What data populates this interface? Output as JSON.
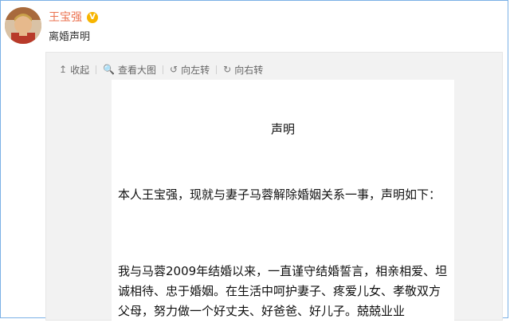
{
  "post": {
    "author": "王宝强",
    "verified_badge": "V",
    "text": "离婚声明"
  },
  "toolbar": {
    "collapse": {
      "icon": "↥",
      "label": "收起"
    },
    "view_large": {
      "icon": "🔍",
      "label": "查看大图"
    },
    "rotate_left": {
      "icon": "↺",
      "label": "向左转"
    },
    "rotate_right": {
      "icon": "↻",
      "label": "向右转"
    }
  },
  "document": {
    "title": "声明",
    "paragraph1": "本人王宝强，现就与妻子马蓉解除婚姻关系一事，声明如下：",
    "paragraph2": "我与马蓉2009年结婚以来，一直谨守结婚誓言，相亲相爱、坦诚相待、忠于婚姻。在生活中呵护妻子、疼爱儿女、孝敬双方父母，努力做一个好丈夫、好爸爸、好儿子。兢兢业业"
  }
}
